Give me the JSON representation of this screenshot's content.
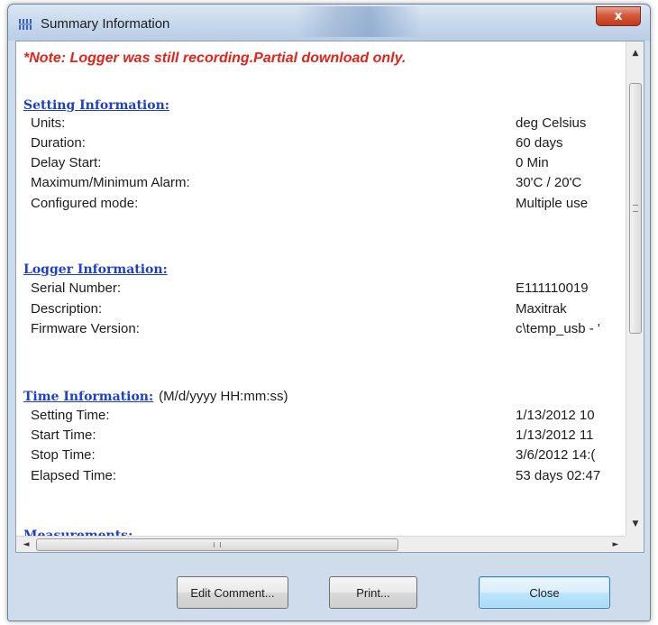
{
  "window": {
    "title": "Summary Information",
    "close_glyph": "x"
  },
  "note": "*Note: Logger was still recording.Partial download only.",
  "setting": {
    "heading": "Setting Information:",
    "rows": [
      {
        "label": "Units:",
        "value": "deg Celsius"
      },
      {
        "label": "Duration:",
        "value": "60 days"
      },
      {
        "label": "Delay Start:",
        "value": "0 Min"
      },
      {
        "label": "Maximum/Minimum Alarm:",
        "value": "30'C / 20'C"
      },
      {
        "label": "Configured mode:",
        "value": "Multiple use"
      }
    ]
  },
  "logger": {
    "heading": "Logger Information:",
    "rows": [
      {
        "label": "Serial Number:",
        "value": "E111110019"
      },
      {
        "label": "Description:",
        "value": "Maxitrak"
      },
      {
        "label": "Firmware Version:",
        "value": "c\\temp_usb - '"
      }
    ]
  },
  "time": {
    "heading": "Time Information:",
    "format": "(M/d/yyyy HH:mm:ss)",
    "rows": [
      {
        "label": "Setting Time:",
        "value": "1/13/2012 10"
      },
      {
        "label": "Start Time:",
        "value": "1/13/2012 11"
      },
      {
        "label": "Stop Time:",
        "value": "3/6/2012 14:("
      },
      {
        "label": "Elapsed Time:",
        "value": "53 days 02:47"
      }
    ]
  },
  "measurements": {
    "heading": "Measurements:"
  },
  "scrollbars": {
    "up": "▲",
    "down": "▼",
    "left": "◄",
    "right": "►",
    "h_grip": "III"
  },
  "buttons": {
    "edit_comment": "Edit Comment...",
    "print": "Print...",
    "close": "Close"
  },
  "colors": {
    "note": "#e2241a",
    "section_heading": "#1d3fc9",
    "close_button": "#c2391b"
  },
  "icons": {
    "title_icon": "grid-app-icon"
  }
}
